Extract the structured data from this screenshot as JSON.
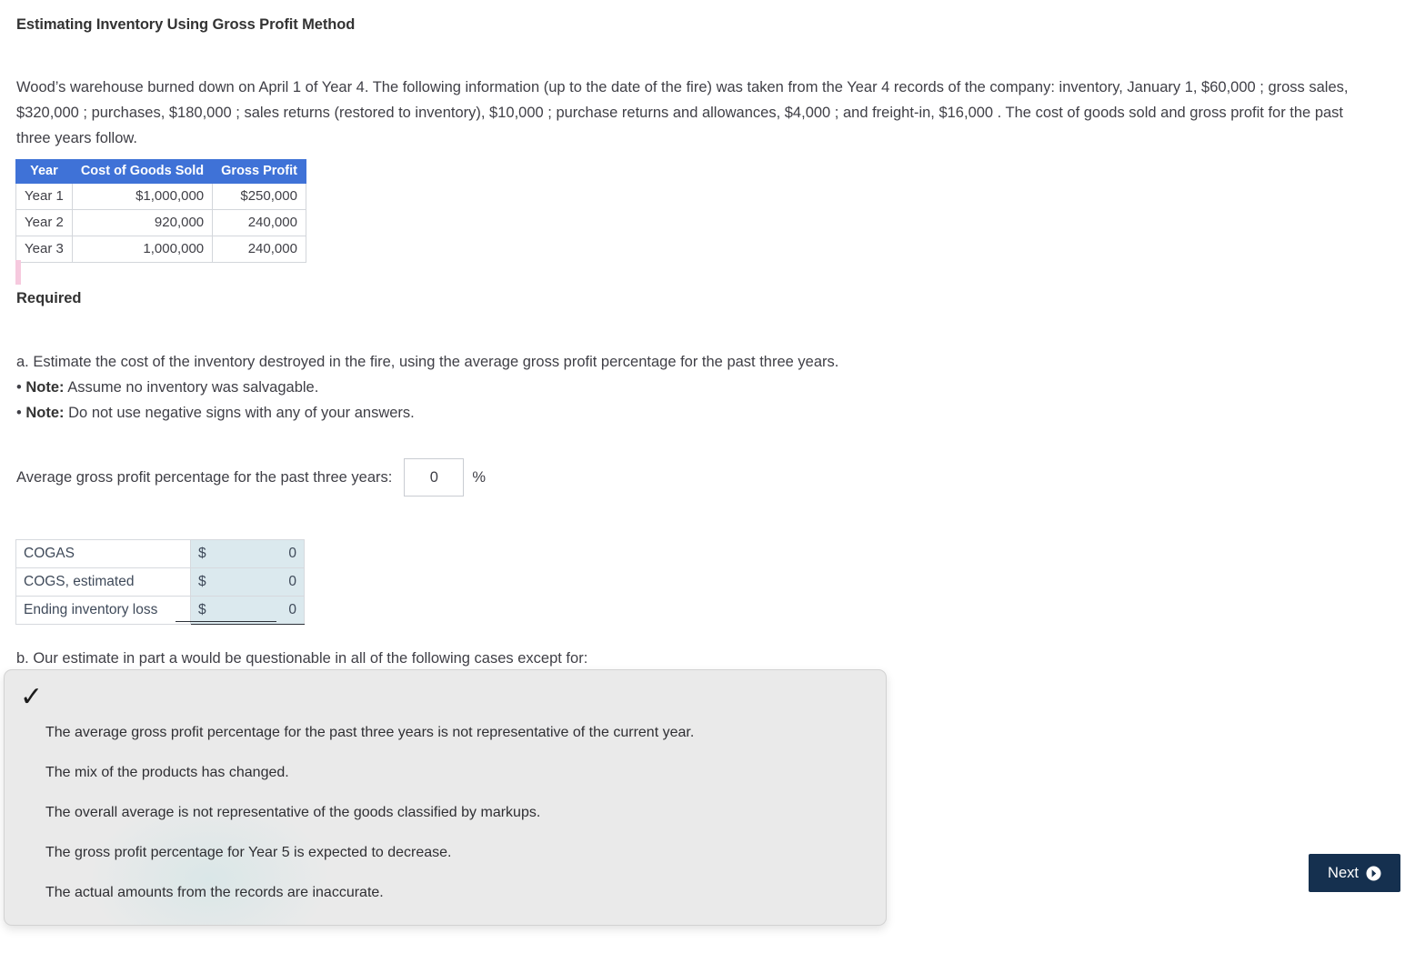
{
  "page_title": "Estimating Inventory Using Gross Profit Method",
  "intro_paragraph": "Wood’s warehouse burned down on April 1 of Year 4. The following information (up to the date of the fire) was taken from the Year 4 records of the company: inventory, January 1, $60,000 ; gross sales, $320,000 ; purchases, $180,000 ; sales returns (restored to inventory), $10,000 ; purchase returns and allowances, $4,000 ; and freight-in, $16,000 . The cost of goods sold and gross profit for the past three years follow.",
  "years_table": {
    "headers": [
      "Year",
      "Cost of Goods Sold",
      "Gross Profit"
    ],
    "rows": [
      [
        "Year 1",
        "$1,000,000",
        "$250,000"
      ],
      [
        "Year 2",
        "920,000",
        "240,000"
      ],
      [
        "Year 3",
        "1,000,000",
        "240,000"
      ]
    ],
    "header_bg": "#3f72d7"
  },
  "required": {
    "heading": "Required",
    "item_a": "a. Estimate the cost of the inventory destroyed in the fire, using the average gross profit percentage for the past three years.",
    "note_label": "Note:",
    "note_1": "Assume no inventory was salvagable.",
    "note_2": "Do not use negative signs with any of your answers.",
    "bullet": "•"
  },
  "percentage_row": {
    "label": "Average gross profit percentage for the past three years:",
    "value": "0",
    "placeholder": "",
    "suffix": "%"
  },
  "cogas_table": {
    "rows": [
      {
        "label": "COGAS",
        "currency": "$",
        "value": "0"
      },
      {
        "label": "COGS, estimated",
        "currency": "$",
        "value": "0"
      },
      {
        "label": "Ending inventory loss",
        "currency": "$",
        "value": "0"
      }
    ],
    "cell_bg": "#dbe9ee"
  },
  "part_b": {
    "prompt": "b. Our estimate in part a would be questionable in all of the following cases except for:",
    "checkmark": "✓",
    "options": [
      "The average gross profit percentage for the past three years is not representative of the current year.",
      "The mix of the products has changed.",
      "The overall average is not representative of the goods classified by markups.",
      "The gross profit percentage for Year 5 is expected to decrease.",
      "The actual amounts from the records are inaccurate."
    ]
  },
  "next_button": {
    "label": "Next",
    "bg": "#15304f"
  }
}
